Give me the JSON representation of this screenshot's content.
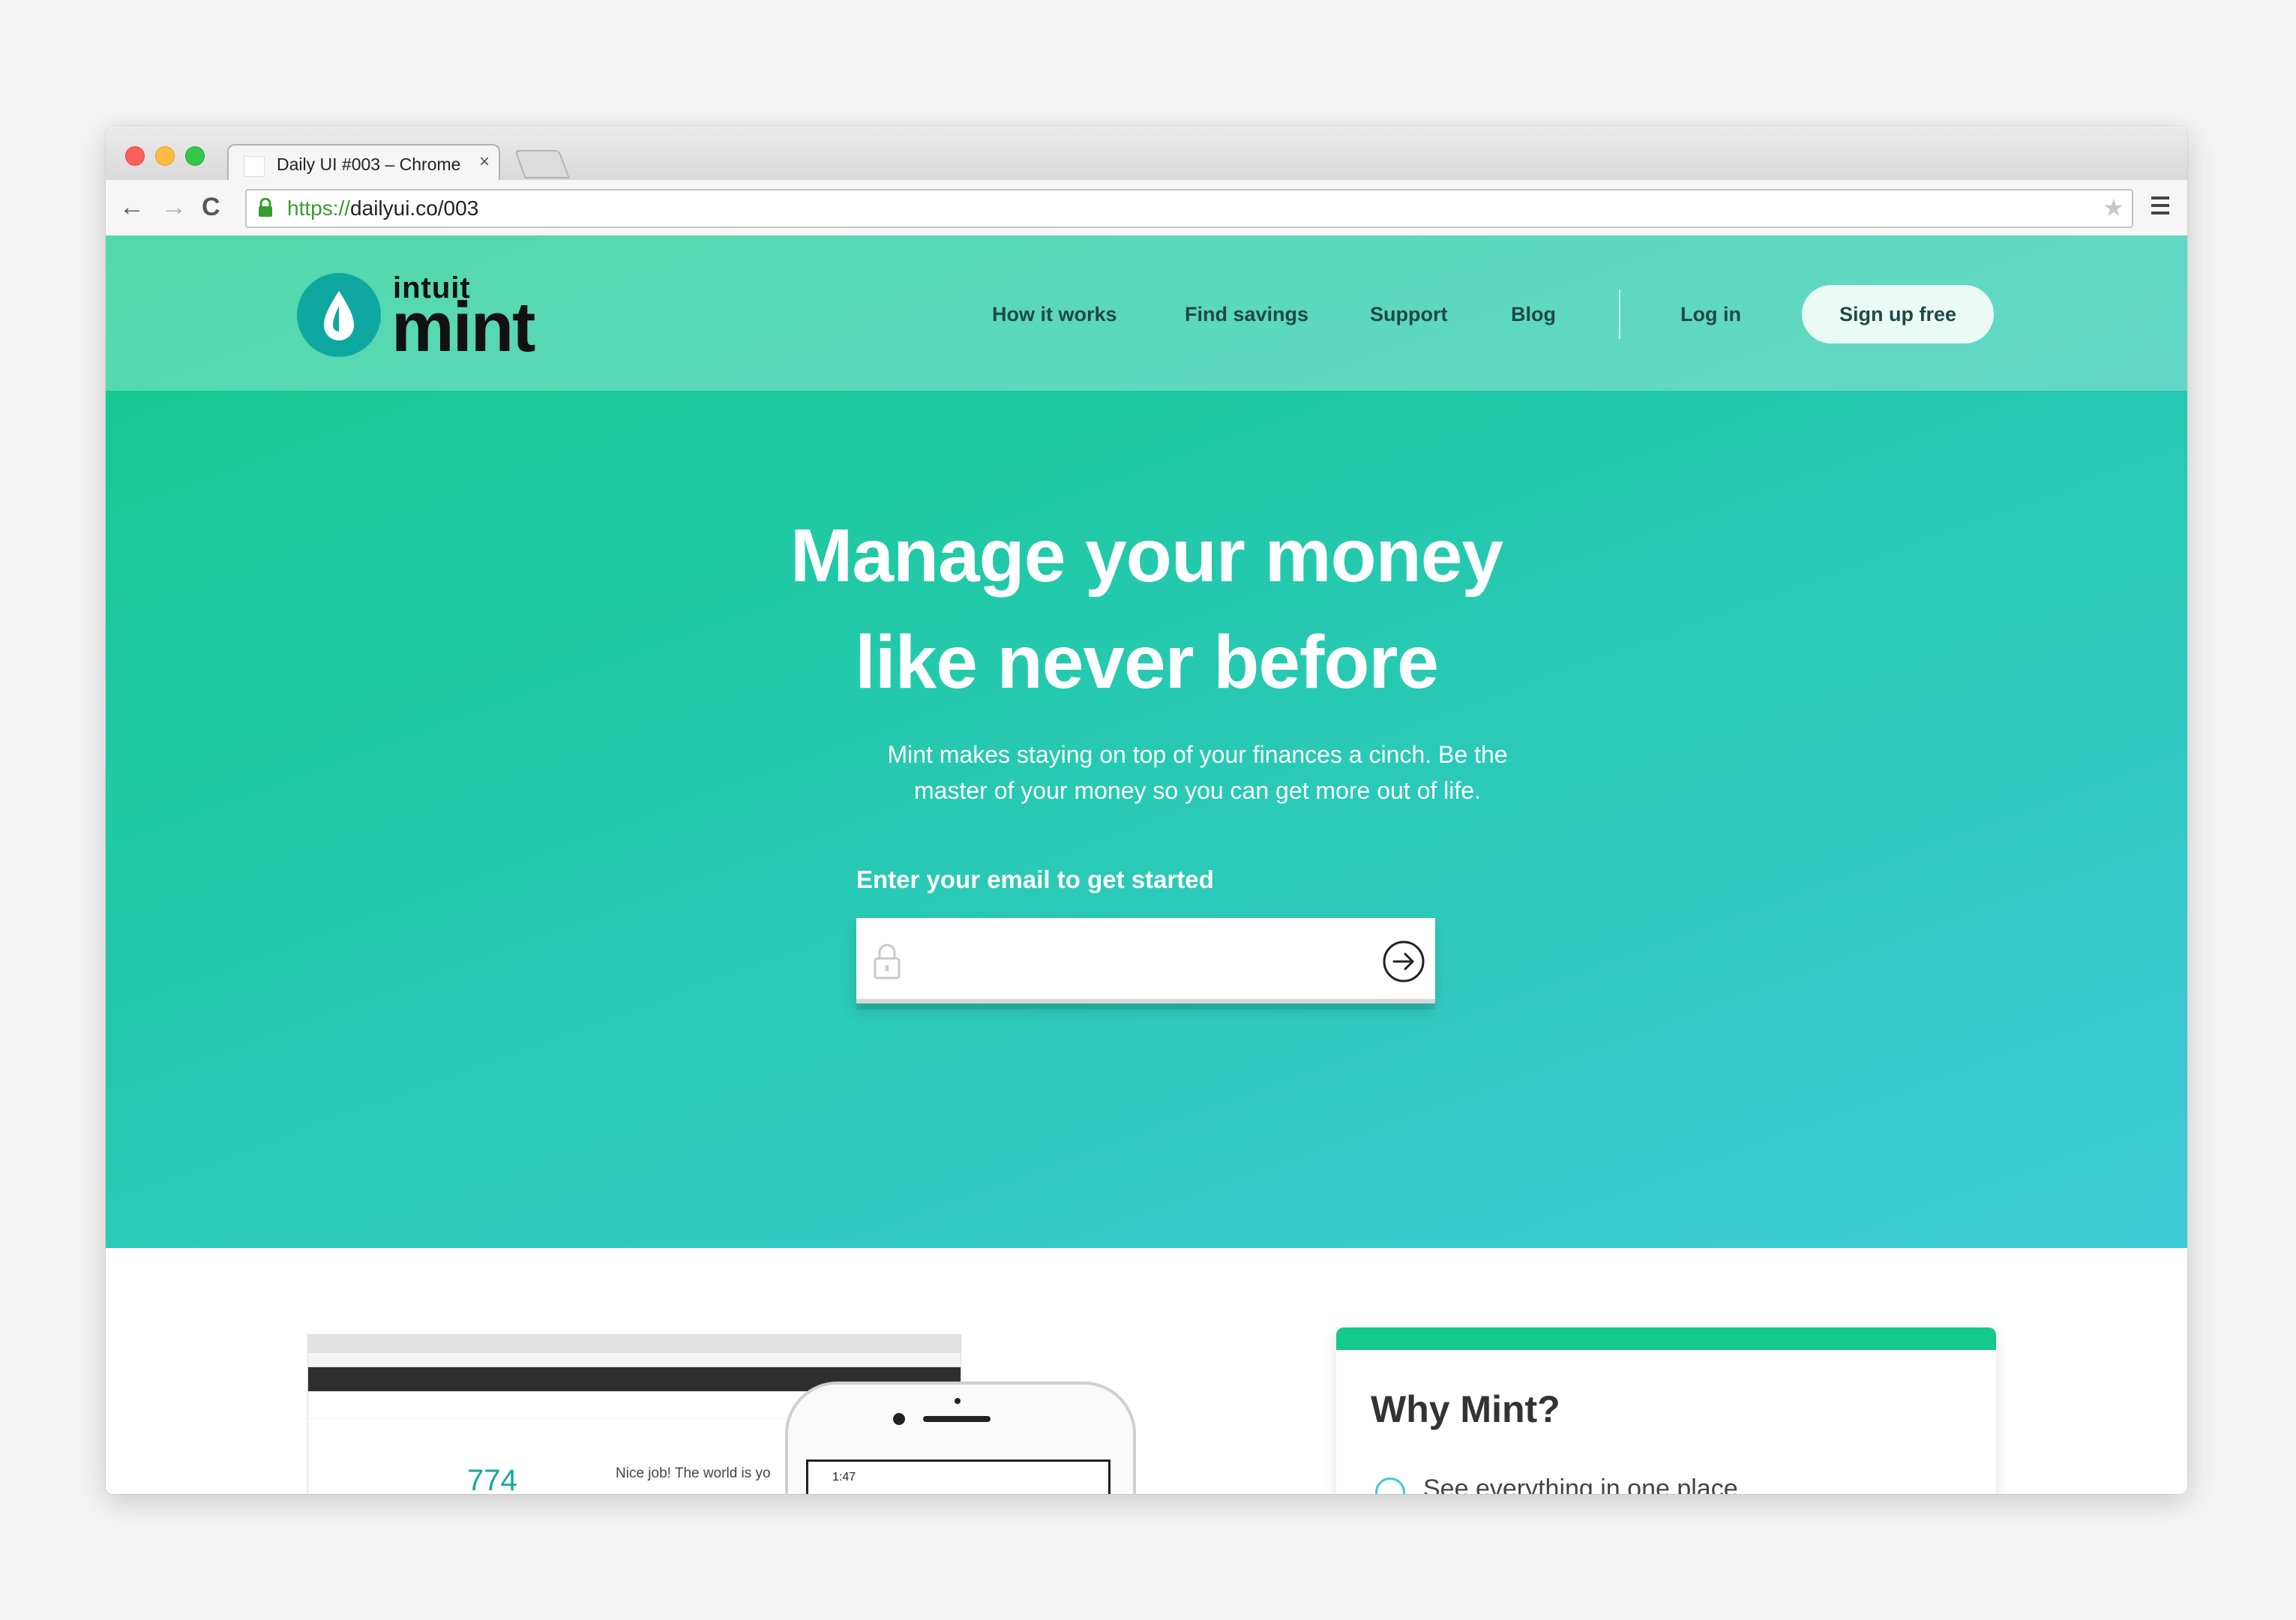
{
  "browser": {
    "tab_title": "Daily UI #003 – Chrome",
    "tab_close": "×",
    "url_scheme": "https://",
    "url_rest": "dailyui.co/003",
    "back_icon": "←",
    "forward_icon": "→",
    "reload_icon": "C",
    "star_icon": "★"
  },
  "logo": {
    "brand": "intuit",
    "product": "mint"
  },
  "nav": {
    "items": [
      "How it works",
      "Find savings",
      "Support",
      "Blog"
    ],
    "login": "Log in",
    "signup": "Sign up free"
  },
  "hero": {
    "headline_line1": "Manage your money",
    "headline_line2": "like never before",
    "subtext": "Mint makes staying on top of your finances a cinch. Be the master of your money so you can get more out of life.",
    "email_label": "Enter your email to get started",
    "email_value": ""
  },
  "preview": {
    "credit_score": "774",
    "message": "Nice job! The world is yo",
    "phone_time": "1:47"
  },
  "why": {
    "title": "Why Mint?",
    "first_item": "See everything in one place"
  },
  "colors": {
    "hero_start": "#12c98a",
    "hero_end": "#3ecbd8",
    "accent": "#13c98b",
    "nav_text": "#1e4a44"
  }
}
